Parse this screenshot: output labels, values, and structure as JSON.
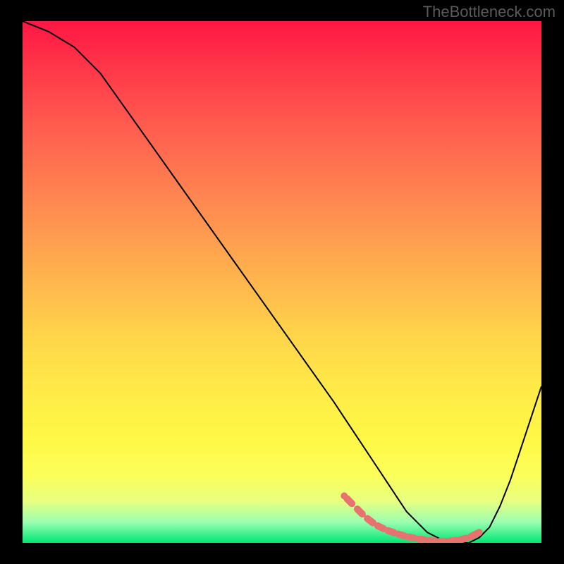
{
  "watermark": "TheBottleneck.com",
  "chart_data": {
    "type": "line",
    "title": "",
    "xlabel": "",
    "ylabel": "",
    "xlim": [
      0,
      100
    ],
    "ylim": [
      0,
      100
    ],
    "series": [
      {
        "name": "main-curve",
        "color": "#000000",
        "x": [
          0,
          5,
          10,
          15,
          20,
          25,
          30,
          35,
          40,
          45,
          50,
          55,
          60,
          62,
          64,
          66,
          68,
          70,
          72,
          74,
          76,
          78,
          80,
          82,
          84,
          86,
          88,
          90,
          92,
          94,
          96,
          98,
          100
        ],
        "y": [
          100,
          98,
          95,
          90,
          83,
          76,
          69,
          62,
          55,
          48,
          41,
          34,
          27,
          24,
          21,
          18,
          15,
          12,
          9,
          6,
          4,
          2,
          1,
          0,
          0,
          0,
          1,
          3,
          7,
          12,
          18,
          24,
          30
        ]
      },
      {
        "name": "highlight-segment",
        "color": "#e57373",
        "style": "dotted-thick",
        "x": [
          62,
          64,
          66,
          68,
          70,
          72,
          74,
          76,
          78,
          80,
          82,
          84,
          86,
          88
        ],
        "y": [
          9,
          7,
          5,
          3.5,
          2.5,
          1.8,
          1.2,
          0.8,
          0.5,
          0.3,
          0.3,
          0.5,
          1,
          2
        ]
      }
    ],
    "background_gradient": {
      "stops": [
        {
          "pos": 0,
          "color": "#ff1744"
        },
        {
          "pos": 50,
          "color": "#ffb64e"
        },
        {
          "pos": 85,
          "color": "#fcff59"
        },
        {
          "pos": 100,
          "color": "#00e676"
        }
      ]
    }
  }
}
